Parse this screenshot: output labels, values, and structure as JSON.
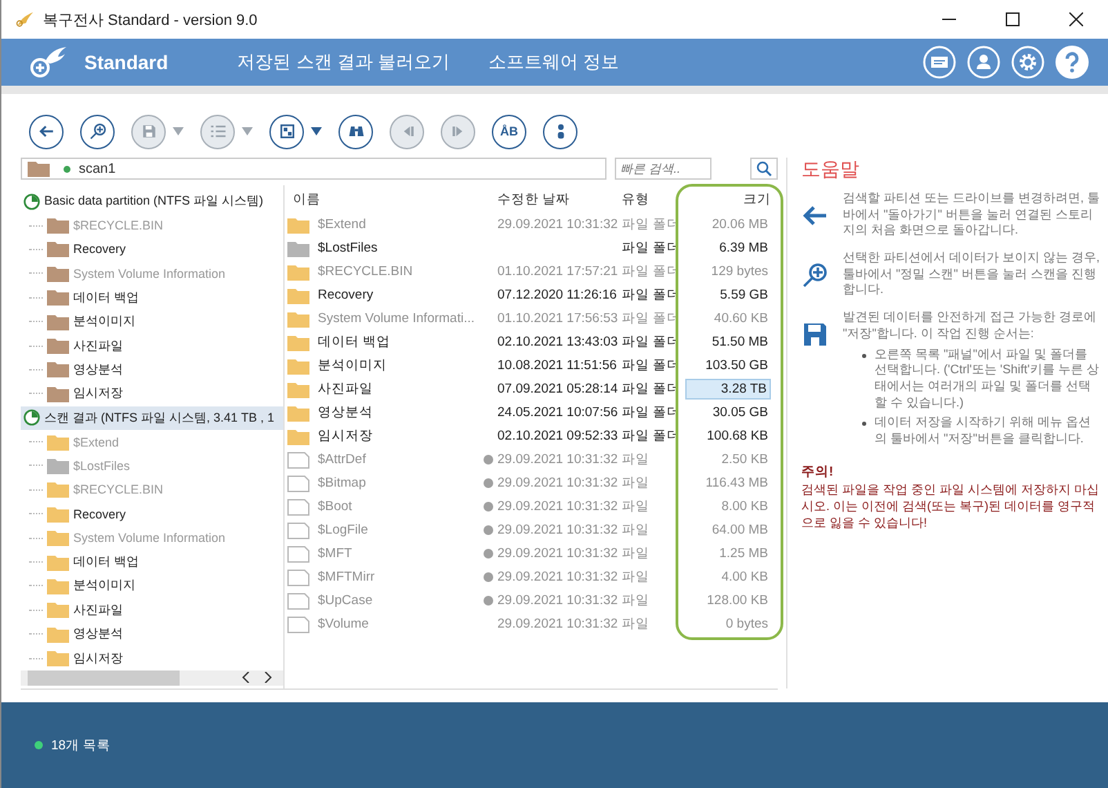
{
  "window": {
    "title": "복구전사 Standard - version 9.0"
  },
  "header": {
    "product": "Standard",
    "nav": [
      {
        "label": "저장된 스캔 결과 불러오기"
      },
      {
        "label": "소프트웨어 정보"
      }
    ],
    "icons": [
      {
        "kind": "card"
      },
      {
        "kind": "user"
      },
      {
        "kind": "settings"
      },
      {
        "kind": "help"
      }
    ]
  },
  "toolbar": [
    {
      "kind": "back",
      "disabled": false
    },
    {
      "kind": "scan",
      "disabled": false
    },
    {
      "kind": "save",
      "disabled": true,
      "dropdown": true
    },
    {
      "kind": "list",
      "disabled": true,
      "dropdown": true
    },
    {
      "kind": "view",
      "disabled": false,
      "dropdown": true
    },
    {
      "kind": "find",
      "disabled": false
    },
    {
      "kind": "prev",
      "disabled": true
    },
    {
      "kind": "next",
      "disabled": true
    },
    {
      "kind": "case",
      "label": "ÅB",
      "disabled": false
    },
    {
      "kind": "info",
      "disabled": false
    }
  ],
  "path": {
    "value": "scan1"
  },
  "search": {
    "placeholder": "빠른 검색.."
  },
  "tree": [
    {
      "label": "Basic data partition (NTFS 파일 시스템)",
      "kind": "partition",
      "selected": false,
      "children": [
        {
          "label": "$RECYCLE.BIN",
          "kind": "existing",
          "dimmed": true,
          "selected": false
        },
        {
          "label": "Recovery",
          "kind": "existing",
          "dimmed": false,
          "selected": false
        },
        {
          "label": "System Volume Information",
          "kind": "existing",
          "dimmed": true,
          "selected": false
        },
        {
          "label": "데이터 백업",
          "kind": "existing",
          "dimmed": false,
          "selected": false
        },
        {
          "label": "분석이미지",
          "kind": "existing",
          "dimmed": false,
          "selected": false
        },
        {
          "label": "사진파일",
          "kind": "existing",
          "dimmed": false,
          "selected": false
        },
        {
          "label": "영상분석",
          "kind": "existing",
          "dimmed": false,
          "selected": false
        },
        {
          "label": "임시저장",
          "kind": "existing",
          "dimmed": false,
          "selected": false
        }
      ]
    },
    {
      "label": "스캔 결과 (NTFS 파일 시스템, 3.41 TB , 1",
      "kind": "partition",
      "selected": true,
      "children": [
        {
          "label": "$Extend",
          "kind": "found",
          "dimmed": true,
          "selected": false
        },
        {
          "label": "$LostFiles",
          "kind": "lost",
          "dimmed": true,
          "selected": false
        },
        {
          "label": "$RECYCLE.BIN",
          "kind": "found",
          "dimmed": true,
          "selected": false
        },
        {
          "label": "Recovery",
          "kind": "found",
          "dimmed": false,
          "selected": false
        },
        {
          "label": "System Volume Information",
          "kind": "found",
          "dimmed": true,
          "selected": false
        },
        {
          "label": "데이터 백업",
          "kind": "found",
          "dimmed": false,
          "selected": false
        },
        {
          "label": "분석이미지",
          "kind": "found",
          "dimmed": false,
          "selected": false
        },
        {
          "label": "사진파일",
          "kind": "found",
          "dimmed": false,
          "selected": false
        },
        {
          "label": "영상분석",
          "kind": "found",
          "dimmed": false,
          "selected": false
        },
        {
          "label": "임시저장",
          "kind": "found",
          "dimmed": false,
          "selected": false
        }
      ]
    }
  ],
  "table": {
    "columns": [
      "이름",
      "수정한 날짜",
      "유형",
      "크기"
    ],
    "rows": [
      {
        "name": "$Extend",
        "kind": "folder",
        "dimmed": true,
        "marked": false,
        "date": "29.09.2021 10:31:32",
        "type": "파일 폴더",
        "size": "20.06 MB",
        "selected": false
      },
      {
        "name": "$LostFiles",
        "kind": "lost",
        "dimmed": false,
        "marked": false,
        "type": "파일 폴더",
        "size": "6.39 MB",
        "selected": false
      },
      {
        "name": "$RECYCLE.BIN",
        "kind": "folder",
        "dimmed": true,
        "marked": false,
        "date": "01.10.2021 17:57:21",
        "type": "파일 폴더",
        "size": "129 bytes",
        "selected": false
      },
      {
        "name": "Recovery",
        "kind": "folder",
        "dimmed": false,
        "marked": false,
        "date": "07.12.2020 11:26:16",
        "type": "파일 폴더",
        "size": "5.59 GB",
        "selected": false
      },
      {
        "name": "System Volume Informati...",
        "kind": "folder",
        "dimmed": true,
        "marked": false,
        "date": "01.10.2021 17:56:53",
        "type": "파일 폴더",
        "size": "40.60 KB",
        "selected": false
      },
      {
        "name": "데이터 백업",
        "kind": "folder",
        "dimmed": false,
        "marked": false,
        "date": "02.10.2021 13:43:03",
        "type": "파일 폴더",
        "size": "51.50 MB",
        "selected": false
      },
      {
        "name": "분석이미지",
        "kind": "folder",
        "dimmed": false,
        "marked": false,
        "date": "10.08.2021 11:51:56",
        "type": "파일 폴더",
        "size": "103.50 GB",
        "selected": false
      },
      {
        "name": "사진파일",
        "kind": "folder",
        "dimmed": false,
        "marked": false,
        "date": "07.09.2021 05:28:14",
        "type": "파일 폴더",
        "size": "3.28 TB",
        "selected": true
      },
      {
        "name": "영상분석",
        "kind": "folder",
        "dimmed": false,
        "marked": false,
        "date": "24.05.2021 10:07:56",
        "type": "파일 폴더",
        "size": "30.05 GB",
        "selected": false
      },
      {
        "name": "임시저장",
        "kind": "folder",
        "dimmed": false,
        "marked": false,
        "date": "02.10.2021 09:52:33",
        "type": "파일 폴더",
        "size": "100.68 KB",
        "selected": false
      },
      {
        "name": "$AttrDef",
        "kind": "file",
        "dimmed": true,
        "marked": true,
        "date": "29.09.2021 10:31:32",
        "type": "파일",
        "size": "2.50 KB",
        "selected": false
      },
      {
        "name": "$Bitmap",
        "kind": "file",
        "dimmed": true,
        "marked": true,
        "date": "29.09.2021 10:31:32",
        "type": "파일",
        "size": "116.43 MB",
        "selected": false
      },
      {
        "name": "$Boot",
        "kind": "file",
        "dimmed": true,
        "marked": true,
        "date": "29.09.2021 10:31:32",
        "type": "파일",
        "size": "8.00 KB",
        "selected": false
      },
      {
        "name": "$LogFile",
        "kind": "file",
        "dimmed": true,
        "marked": true,
        "date": "29.09.2021 10:31:32",
        "type": "파일",
        "size": "64.00 MB",
        "selected": false
      },
      {
        "name": "$MFT",
        "kind": "file",
        "dimmed": true,
        "marked": true,
        "date": "29.09.2021 10:31:32",
        "type": "파일",
        "size": "1.25 MB",
        "selected": false
      },
      {
        "name": "$MFTMirr",
        "kind": "file",
        "dimmed": true,
        "marked": true,
        "date": "29.09.2021 10:31:32",
        "type": "파일",
        "size": "4.00 KB",
        "selected": false
      },
      {
        "name": "$UpCase",
        "kind": "file",
        "dimmed": true,
        "marked": true,
        "date": "29.09.2021 10:31:32",
        "type": "파일",
        "size": "128.00 KB",
        "selected": false
      },
      {
        "name": "$Volume",
        "kind": "file",
        "dimmed": true,
        "marked": false,
        "date": "29.09.2021 10:31:32",
        "type": "파일",
        "size": "0 bytes",
        "selected": false
      }
    ]
  },
  "help": {
    "title": "도움말",
    "items": [
      {
        "kind": "back",
        "text": "검색할 파티션 또는 드라이브를 변경하려면, 툴바에서 \"돌아가기\" 버튼을 눌러 연결된 스토리지의 처음 화면으로 돌아갑니다."
      },
      {
        "kind": "scan",
        "text": "선택한 파티션에서 데이터가 보이지 않는 경우, 툴바에서 \"정밀 스캔\" 버튼을 눌러 스캔을 진행합니다."
      },
      {
        "kind": "save",
        "text": "발견된 데이터를 안전하게 접근 가능한 경로에 \"저장\"합니다. 이 작업 진행 순서는:",
        "bullets": [
          "오른쪽 목록 \"패널\"에서 파일 및 폴더를 선택합니다. ('Ctrl'또는 'Shift'키를 누른 상태에서는 여러개의 파일 및 폴더를 선택할 수 있습니다.)",
          "데이터 저장을 시작하기 위해 메뉴 옵션의 툴바에서 \"저장\"버튼을 클릭합니다."
        ]
      }
    ],
    "warning_title": "주의!",
    "warning": "검색된 파일을 작업 중인 파일 시스템에 저장하지 마십시오. 이는 이전에 검색(또는 복구)된 데이터를 영구적으로 잃을 수 있습니다!"
  },
  "status_bar": {
    "text": "18개 목록"
  }
}
